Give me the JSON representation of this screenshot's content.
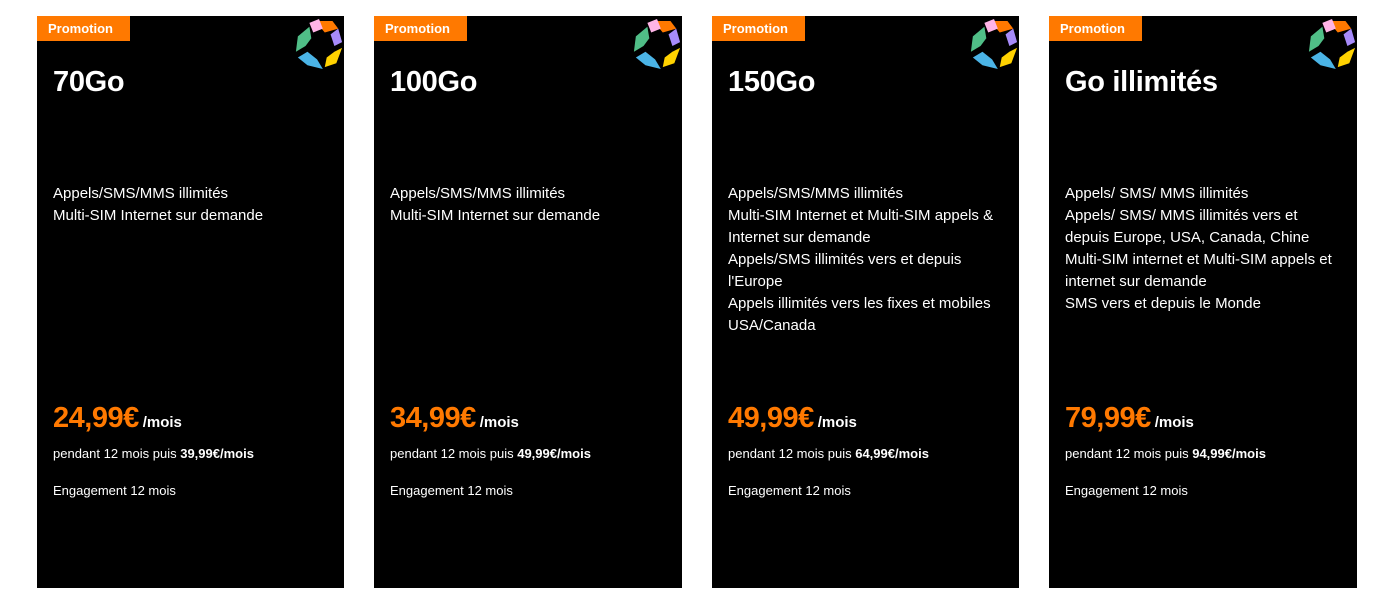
{
  "colors": {
    "accent": "#ff7900",
    "card_background": "#000000",
    "text": "#ffffff"
  },
  "offers": [
    {
      "badge": "Promotion",
      "title": "70Go",
      "features": [
        "Appels/SMS/MMS illimités",
        "Multi-SIM Internet sur demande"
      ],
      "price": "24,99€",
      "price_unit": "/mois",
      "then_prefix": "pendant 12 mois puis",
      "then_price": "39,99€/mois",
      "commitment": "Engagement 12 mois"
    },
    {
      "badge": "Promotion",
      "title": "100Go",
      "features": [
        "Appels/SMS/MMS illimités",
        "Multi-SIM Internet sur demande"
      ],
      "price": "34,99€",
      "price_unit": "/mois",
      "then_prefix": "pendant 12 mois puis",
      "then_price": "49,99€/mois",
      "commitment": "Engagement 12 mois"
    },
    {
      "badge": "Promotion",
      "title": "150Go",
      "features": [
        "Appels/SMS/MMS illimités",
        "Multi-SIM Internet et Multi-SIM appels & Internet sur demande",
        "Appels/SMS illimités vers et depuis l'Europe",
        "Appels illimités vers les fixes et mobiles USA/Canada"
      ],
      "price": "49,99€",
      "price_unit": "/mois",
      "then_prefix": "pendant 12 mois puis",
      "then_price": "64,99€/mois",
      "commitment": "Engagement 12 mois"
    },
    {
      "badge": "Promotion",
      "title": "Go illimités",
      "features": [
        "Appels/ SMS/ MMS illimités",
        "Appels/ SMS/ MMS illimités vers et depuis Europe, USA, Canada, Chine",
        "Multi-SIM internet et Multi-SIM appels et internet sur demande",
        "SMS vers et depuis le Monde"
      ],
      "price": "79,99€",
      "price_unit": "/mois",
      "then_prefix": "pendant 12 mois puis",
      "then_price": "94,99€/mois",
      "commitment": "Engagement 12 mois"
    }
  ]
}
